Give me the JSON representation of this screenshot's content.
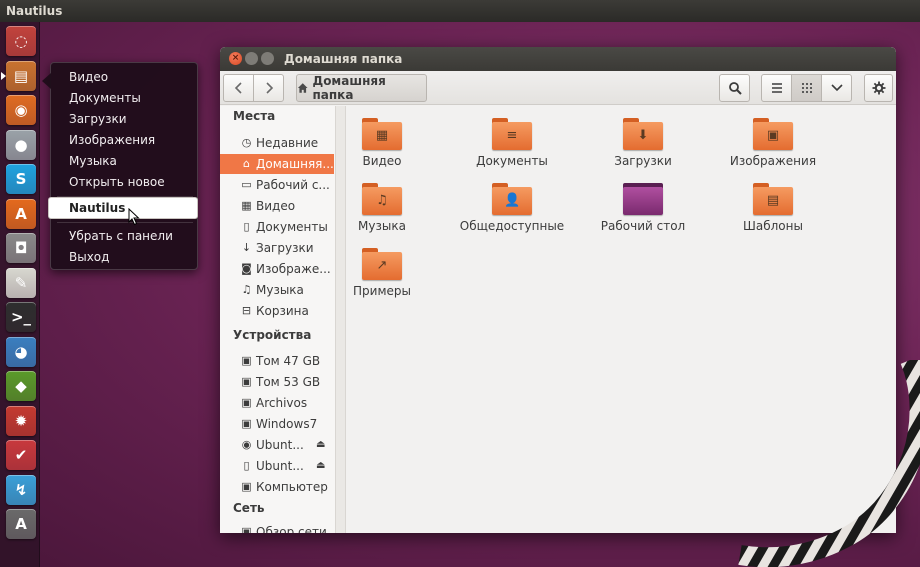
{
  "top_panel": {
    "title": "Nautilus"
  },
  "launcher": {
    "items": [
      {
        "name": "ubuntu-dash-icon",
        "glyph": "◌",
        "color": "#c2433c"
      },
      {
        "name": "files-icon",
        "glyph": "▤",
        "color": "#c9732f"
      },
      {
        "name": "firefox-icon",
        "glyph": "◉",
        "color": "#e06c22"
      },
      {
        "name": "pidgin-icon",
        "glyph": "●",
        "color": "#9aa2a8"
      },
      {
        "name": "skype-icon",
        "glyph": "S",
        "color": "#1fa3e0"
      },
      {
        "name": "software-center-icon",
        "glyph": "A",
        "color": "#e46a1e"
      },
      {
        "name": "camera-icon",
        "glyph": "◘",
        "color": "#8a8a8a"
      },
      {
        "name": "text-editor-icon",
        "glyph": "✎",
        "color": "#d8d8d0"
      },
      {
        "name": "terminal-icon",
        "glyph": ">_",
        "color": "#2e2e2e"
      },
      {
        "name": "browser-icon",
        "glyph": "◕",
        "color": "#3a7fc0"
      },
      {
        "name": "inkscape-icon",
        "glyph": "◆",
        "color": "#5a9a2a"
      },
      {
        "name": "settings-icon",
        "glyph": "✹",
        "color": "#c43a30"
      },
      {
        "name": "tasks-icon",
        "glyph": "✔",
        "color": "#c8393d"
      },
      {
        "name": "update-icon",
        "glyph": "↯",
        "color": "#3aa0d8"
      },
      {
        "name": "updater-icon",
        "glyph": "A",
        "color": "#6a6a6a"
      }
    ]
  },
  "quicklist": {
    "items": [
      "Видео",
      "Документы",
      "Загрузки",
      "Изображения",
      "Музыка",
      "Открыть новое окно"
    ],
    "active": "Nautilus",
    "bottom": [
      "Убрать с панели",
      "Выход"
    ]
  },
  "window": {
    "title": "Домашняя папка",
    "path_button": "Домашняя папка",
    "close_glyph": "×"
  },
  "sidebar": {
    "places_heading": "Места",
    "places": [
      {
        "label": "Недавние",
        "icon": "◷"
      },
      {
        "label": "Домашняя...",
        "icon": "⌂"
      },
      {
        "label": "Рабочий с...",
        "icon": "▭"
      },
      {
        "label": "Видео",
        "icon": "▦"
      },
      {
        "label": "Документы",
        "icon": "▯"
      },
      {
        "label": "Загрузки",
        "icon": "↓"
      },
      {
        "label": "Изображе...",
        "icon": "◙"
      },
      {
        "label": "Музыка",
        "icon": "♫"
      },
      {
        "label": "Корзина",
        "icon": "⊟"
      }
    ],
    "devices_heading": "Устройства",
    "devices": [
      {
        "label": "Том 47 GB",
        "icon": "▣"
      },
      {
        "label": "Том 53 GB",
        "icon": "▣"
      },
      {
        "label": "Archivos",
        "icon": "▣"
      },
      {
        "label": "Windows7",
        "icon": "▣"
      },
      {
        "label": "Ubunt...",
        "icon": "◉",
        "eject": "⏏"
      },
      {
        "label": "Ubunt...",
        "icon": "▯",
        "eject": "⏏"
      },
      {
        "label": "Компьютер",
        "icon": "▣"
      }
    ],
    "network_heading": "Сеть",
    "network": [
      {
        "label": "Обзор сети",
        "icon": "▣"
      }
    ]
  },
  "files": [
    {
      "label": "Видео",
      "emblem": "▦"
    },
    {
      "label": "Документы",
      "emblem": "≡"
    },
    {
      "label": "Загрузки",
      "emblem": "⬇"
    },
    {
      "label": "Изображения",
      "emblem": "▣"
    },
    {
      "label": "Музыка",
      "emblem": "♫"
    },
    {
      "label": "Общедоступные",
      "emblem": "👤"
    },
    {
      "label": "Рабочий стол",
      "emblem": ""
    },
    {
      "label": "Шаблоны",
      "emblem": "▤"
    },
    {
      "label": "Примеры",
      "emblem": "↗"
    }
  ]
}
